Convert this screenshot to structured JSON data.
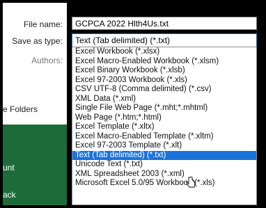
{
  "fields": {
    "filename_label": "File name:",
    "filename_value": "GCPCA 2022 Hlth4Us.txt",
    "savetype_label": "Save as type:",
    "savetype_value": "Text (Tab delimited) (*.txt)",
    "authors_label": "Authors:"
  },
  "sidebar": {
    "folders_label": "e Folders",
    "green_items": [
      "unt",
      "ack"
    ]
  },
  "dropdown_options": [
    "Excel Workbook (*.xlsx)",
    "Excel Macro-Enabled Workbook (*.xlsm)",
    "Excel Binary Workbook (*.xlsb)",
    "Excel 97-2003 Workbook (*.xls)",
    "CSV UTF-8 (Comma delimited) (*.csv)",
    "XML Data (*.xml)",
    "Single File Web Page (*.mht;*.mhtml)",
    "Web Page (*.htm;*.html)",
    "Excel Template (*.xltx)",
    "Excel Macro-Enabled Template (*.xltm)",
    "Excel 97-2003 Template (*.xlt)",
    "Text (Tab delimited) (*.txt)",
    "Unicode Text (*.txt)",
    "XML Spreadsheet 2003 (*.xml)",
    "Microsoft Excel 5.0/95 Workbook (*.xls)"
  ],
  "selected_index": 11,
  "colors": {
    "highlight": "#1a73d9",
    "green": "#1e6b3a"
  }
}
